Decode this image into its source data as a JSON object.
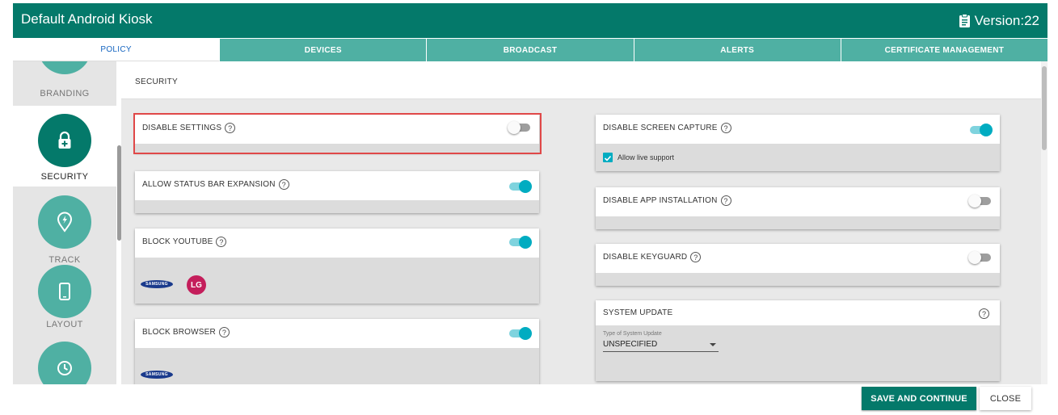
{
  "app": {
    "title": "Default Android Kiosk",
    "version": "Version:22"
  },
  "tabs": [
    {
      "label": "POLICY",
      "active": true
    },
    {
      "label": "DEVICES"
    },
    {
      "label": "BROADCAST"
    },
    {
      "label": "ALERTS"
    },
    {
      "label": "CERTIFICATE MANAGEMENT"
    }
  ],
  "sidebar": {
    "items": [
      {
        "label": "BRANDING",
        "icon": "branding-icon"
      },
      {
        "label": "SECURITY",
        "icon": "lock-icon",
        "active": true
      },
      {
        "label": "TRACK",
        "icon": "location-pin-icon"
      },
      {
        "label": "LAYOUT",
        "icon": "phone-icon"
      },
      {
        "label": "",
        "icon": "clock-icon"
      }
    ]
  },
  "section": {
    "title": "SECURITY"
  },
  "settings": {
    "disable_settings": {
      "label": "DISABLE SETTINGS",
      "enabled": false
    },
    "allow_status_bar": {
      "label": "ALLOW STATUS BAR EXPANSION",
      "enabled": true
    },
    "block_youtube": {
      "label": "BLOCK YOUTUBE",
      "enabled": true,
      "brands": [
        "SAMSUNG",
        "LG"
      ]
    },
    "block_browser": {
      "label": "BLOCK BROWSER",
      "enabled": true,
      "brands": [
        "SAMSUNG"
      ]
    },
    "disable_screen_capture": {
      "label": "DISABLE SCREEN CAPTURE",
      "enabled": true,
      "option_label": "Allow live support",
      "option_checked": true
    },
    "disable_app_installation": {
      "label": "DISABLE APP INSTALLATION",
      "enabled": false
    },
    "disable_keyguard": {
      "label": "DISABLE KEYGUARD",
      "enabled": false
    },
    "system_update": {
      "label": "SYSTEM UPDATE",
      "select_caption": "Type of System Update",
      "select_value": "UNSPECIFIED"
    }
  },
  "help_glyph": "?",
  "footer": {
    "save_label": "SAVE AND CONTINUE",
    "close_label": "CLOSE"
  },
  "colors": {
    "brand": "#04796a",
    "tab": "#4fb0a3",
    "toggle_on": "#00acc1",
    "highlight": "#e04848",
    "active_tab_text": "#1565c0"
  }
}
